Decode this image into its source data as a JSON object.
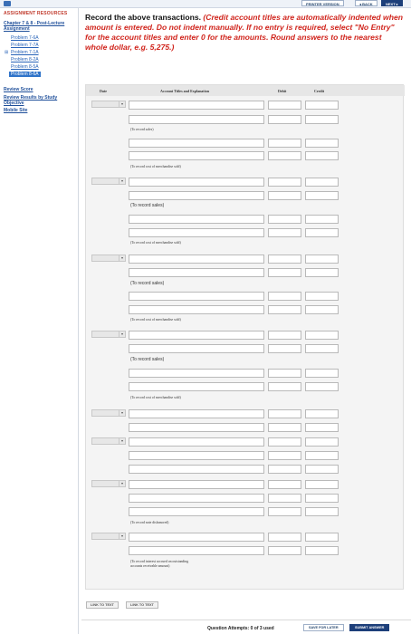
{
  "toolbar": {
    "printer_version": "PRINTER VERSION",
    "back": "◂ BACK",
    "next": "NEXT ▸"
  },
  "sidebar": {
    "heading": "ASSIGNMENT RESOURCES",
    "chapter_link": "Chapter 7 & 8 - Post-Lecture Assignment",
    "problems": [
      "Problem 7-6A",
      "Problem 7-7A",
      "Problem 7-1A",
      "Problem 8-2A",
      "Problem 8-5A",
      "Problem 8-6A"
    ],
    "expand_glyph": "⊞",
    "review_score": "Review Score",
    "review_results": "Review Results by Study Objective",
    "mobile_site": "Mobile Site"
  },
  "instructions": {
    "lead": "Record the above transactions.",
    "rules": "(Credit account titles are automatically indented when amount is entered. Do not indent manually. If no entry is required, select \"No Entry\" for the account titles and enter 0 for the amounts. Round answers to the nearest whole dollar, e.g. 5,275.)"
  },
  "table": {
    "headers": {
      "date": "Date",
      "account": "Account Titles and Explanation",
      "debit": "Debit",
      "credit": "Credit"
    },
    "notes": {
      "record_sales": "(To record sales)",
      "record_cogs": "(To record cost of merchandise sold)",
      "note_dishonored": "(To record note dishonored)",
      "interest_accrued": "(To record interest accrued on outstanding accounts receivable amount)"
    },
    "select_arrow": "▾"
  },
  "links": {
    "link_to_text_1": "LINK TO TEXT",
    "link_to_text_2": "LINK TO TEXT"
  },
  "footer": {
    "attempts": "Question Attempts: 0 of 3 used",
    "save_for_later": "SAVE FOR LATER",
    "submit_answer": "SUBMIT ANSWER"
  },
  "colors": {
    "instruction_red": "#d0241c",
    "link_blue": "#2863b8",
    "nav_dark": "#1d3f7a"
  }
}
